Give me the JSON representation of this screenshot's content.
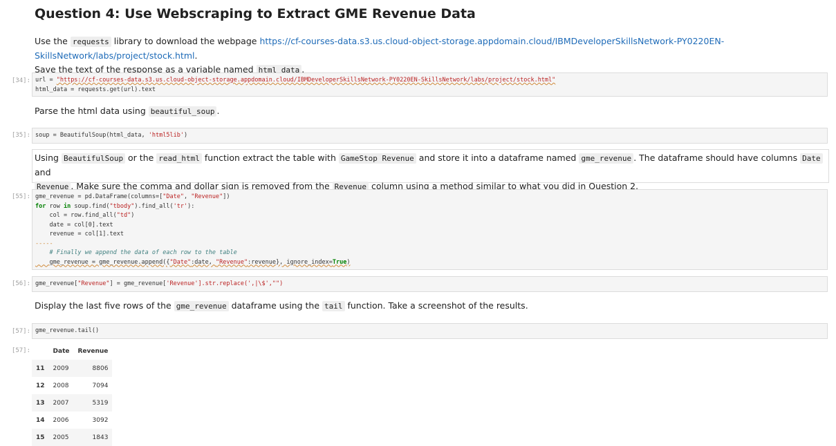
{
  "heading": "Question 4: Use Webscraping to Extract GME Revenue Data",
  "intro": {
    "t1": "Use the ",
    "code1": "requests",
    "t2": " library to download the webpage ",
    "link": "https://cf-courses-data.s3.us.cloud-object-storage.appdomain.cloud/IBMDeveloperSkillsNetwork-PY0220EN-SkillsNetwork/labs/project/stock.html",
    "t3": ".",
    "t4": "Save the text of the response as a variable named ",
    "code2": "html_data",
    "t5": "."
  },
  "cells": {
    "c34": {
      "prompt": "[34]:",
      "line1_a": "url = ",
      "line1_str": "\"https://cf-courses-data.s3.us.cloud-object-storage.appdomain.cloud/IBMDeveloperSkillsNetwork-PY0220EN-SkillsNetwork/labs/project/stock.html\"",
      "line2": "html_data = requests.get(url).text"
    },
    "parse_md": {
      "t1": "Parse the html data using ",
      "code": "beautiful_soup",
      "t2": "."
    },
    "c35": {
      "prompt": "[35]:",
      "a": "soup = BeautifulSoup(html_data, ",
      "str": "'html5lib'",
      "b": ")"
    },
    "using_md": {
      "t1": "Using ",
      "c1": "BeautifulSoup",
      "t2": " or the ",
      "c2": "read_html",
      "t3": " function extract the table with ",
      "c3": "GameStop Revenue",
      "t4": " and store it into a dataframe named ",
      "c4": "gme_revenue",
      "t5": ". The dataframe should have columns ",
      "c5": "Date",
      "t6": " and",
      "c6": "Revenue",
      "t7": ". Make sure the comma and dollar sign is removed from the ",
      "c7": "Revenue",
      "t8": " column using a method similar to what you did in Question 2."
    },
    "c55": {
      "prompt": "[55]:",
      "l1a": "gme_revenue = pd.DataFrame(columns=[",
      "l1s1": "\"Date\"",
      "l1b": ", ",
      "l1s2": "\"Revenue\"",
      "l1c": "])",
      "l2kw1": "for",
      "l2a": " row ",
      "l2kw2": "in",
      "l2b": " soup.find(",
      "l2s": "\"tbody\"",
      "l2c": ").find_all(",
      "l2s2": "'tr'",
      "l2d": "):",
      "l3a": "    col = row.find_all(",
      "l3s": "\"td\"",
      "l3b": ")",
      "l4": "    date = col[0].text",
      "l5": "    revenue = col[1].text",
      "l6": "-----",
      "l7": "    # Finally we append the data of each row to the table",
      "l8a": "    gme_revenue = gme_revenue.append({",
      "l8s1": "\"Date\"",
      "l8b": ":date, ",
      "l8s2": "\"Revenue\"",
      "l8c": ":revenue}, ignore_index=",
      "l8kw": "True",
      "l8d": ")"
    },
    "c56": {
      "prompt": "[56]:",
      "a": "gme_revenue[",
      "s1": "\"Revenue\"",
      "b": "] = gme_revenue[",
      "s2": "'Revenue'",
      "c": "].str.replace(',|\\$',\"\")"
    },
    "display_md": {
      "t1": "Display the last five rows of the ",
      "c1": "gme_revenue",
      "t2": " dataframe using the ",
      "c2": "tail",
      "t3": " function. Take a screenshot of the results."
    },
    "c57": {
      "prompt": "[57]:",
      "code": "gme_revenue.tail()",
      "out_prompt": "[57]:"
    }
  },
  "table": {
    "headers": [
      "",
      "Date",
      "Revenue"
    ],
    "rows": [
      {
        "idx": "11",
        "date": "2009",
        "revenue": "8806"
      },
      {
        "idx": "12",
        "date": "2008",
        "revenue": "7094"
      },
      {
        "idx": "13",
        "date": "2007",
        "revenue": "5319"
      },
      {
        "idx": "14",
        "date": "2006",
        "revenue": "3092"
      },
      {
        "idx": "15",
        "date": "2005",
        "revenue": "1843"
      }
    ]
  }
}
